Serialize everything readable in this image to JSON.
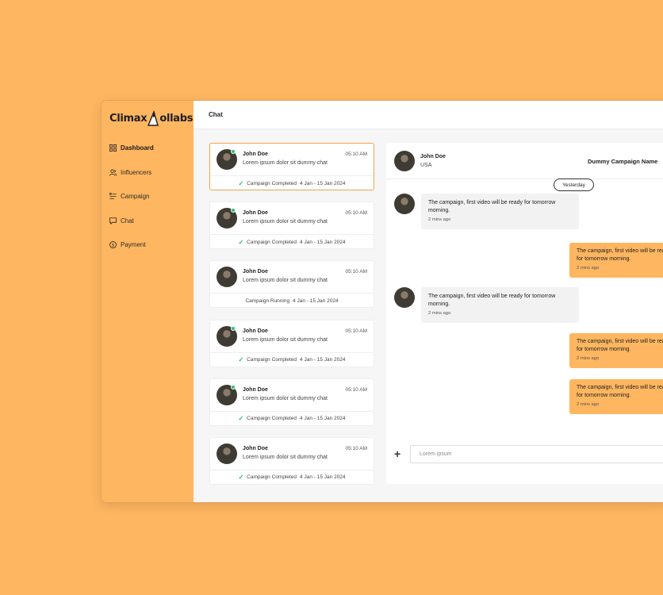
{
  "app": {
    "logo_text_1": "Climax",
    "logo_text_2": "ollabs"
  },
  "sidebar": {
    "items": [
      {
        "label": "Dashboard",
        "icon": "grid-icon",
        "active": true
      },
      {
        "label": "Influencers",
        "icon": "users-icon"
      },
      {
        "label": "Campaign",
        "icon": "list-icon"
      },
      {
        "label": "Chat",
        "icon": "chat-bubble-icon"
      },
      {
        "label": "Payment",
        "icon": "dollar-circle-icon"
      }
    ]
  },
  "header": {
    "title": "Chat"
  },
  "chat_list": [
    {
      "name": "John Doe",
      "time": "05:10 AM",
      "preview": "Lorem ipsum dolor sit dummy chat",
      "status": "Campaign Completed",
      "dates": "4 Jan - 15 Jan 2024",
      "completed": true,
      "online": true
    },
    {
      "name": "John Doe",
      "time": "05:10 AM",
      "preview": "Lorem ipsum dolor sit dummy chat",
      "status": "Campaign Completed",
      "dates": "4 Jan - 15 Jan 2024",
      "completed": true,
      "online": true
    },
    {
      "name": "John Doe",
      "time": "05:10 AM",
      "preview": "Lorem ipsum dolor sit dummy chat",
      "status": "Campaign Running",
      "dates": "4 Jan - 15 Jan 2024",
      "completed": false,
      "online": false
    },
    {
      "name": "John Doe",
      "time": "05:10 AM",
      "preview": "Lorem ipsum dolor sit dummy chat",
      "status": "Campaign Completed",
      "dates": "4 Jan - 15 Jan 2024",
      "completed": true,
      "online": true
    },
    {
      "name": "John Doe",
      "time": "05:10 AM",
      "preview": "Lorem ipsum dolor sit dummy chat",
      "status": "Campaign Completed",
      "dates": "4 Jan - 15 Jan 2024",
      "completed": true,
      "online": true
    },
    {
      "name": "John Doe",
      "time": "05:10 AM",
      "preview": "Lorem ipsum dolor sit dummy chat",
      "status": "Campaign Completed",
      "dates": "4 Jan - 15 Jan 2024",
      "completed": true,
      "online": false
    }
  ],
  "conversation": {
    "name": "John Doe",
    "country": "USA",
    "campaign": "Dummy Campaign Name",
    "date_separator": "Yesterday",
    "messages": [
      {
        "dir": "in",
        "text": "The campaign, first video will be ready for tomorrow morning.",
        "time": "2 mins ago"
      },
      {
        "dir": "out",
        "text": "The campaign, first video will be ready for tomorrow morning.",
        "time": "2 mins ago"
      },
      {
        "dir": "in",
        "text": "The campaign, first video will be ready for tomorrow morning.",
        "time": "2 mins ago"
      },
      {
        "dir": "out",
        "text": "The campaign, first video will be ready for tomorrow morning.",
        "time": "2 mins ago"
      },
      {
        "dir": "out",
        "text": "The campaign, first video will be ready for tomorrow morning.",
        "time": "2 mins ago"
      }
    ],
    "input_placeholder": "Lorem ipsum"
  }
}
